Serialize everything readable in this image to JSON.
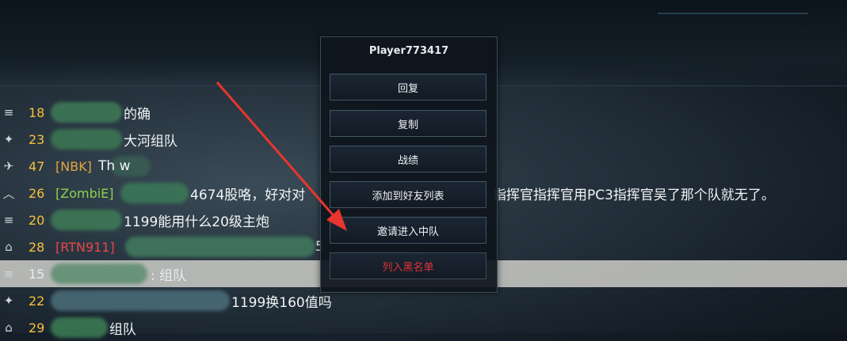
{
  "chat": {
    "rows": [
      {
        "rank_icon": "medal-icon",
        "level": "18",
        "tag": "",
        "text": "的确"
      },
      {
        "rank_icon": "wings-icon",
        "level": "23",
        "tag": "",
        "text": "大河组队"
      },
      {
        "rank_icon": "eagle-icon",
        "level": "47",
        "tag": "[NBK]",
        "text": "Th      w"
      },
      {
        "rank_icon": "chevron-icon",
        "level": "26",
        "tag": "[ZombiE]",
        "text": "4674股咯，好对对"
      },
      {
        "rank_icon": "medal-icon",
        "level": "20",
        "tag": "",
        "text": "1199能用什么20级主炮"
      },
      {
        "rank_icon": "star-icon",
        "level": "28",
        "tag": "[RTN911]",
        "text": "5"
      },
      {
        "rank_icon": "medal-icon",
        "level": "15",
        "tag": "",
        "text": ": 组队"
      },
      {
        "rank_icon": "wings-icon",
        "level": "22",
        "tag": "",
        "text": "1199换160值吗"
      },
      {
        "rank_icon": "star-icon",
        "level": "29",
        "tag": "",
        "text": "组队"
      }
    ],
    "overflow_text": "指挥官指挥官用PC3指挥官吴了那个队就无了。"
  },
  "menu": {
    "title": "Player773417",
    "items": [
      {
        "label": "回复"
      },
      {
        "label": "复制"
      },
      {
        "label": "战绩"
      },
      {
        "label": "添加到好友列表"
      },
      {
        "label": "邀请进入中队"
      },
      {
        "label": "列入黑名单"
      }
    ]
  },
  "colors": {
    "level": "#f5c13c",
    "tag_green": "#8fd14f",
    "tag_red": "#e8474a",
    "tag_orange": "#e3a640",
    "danger": "#e0333a",
    "arrow": "#e8352e"
  }
}
